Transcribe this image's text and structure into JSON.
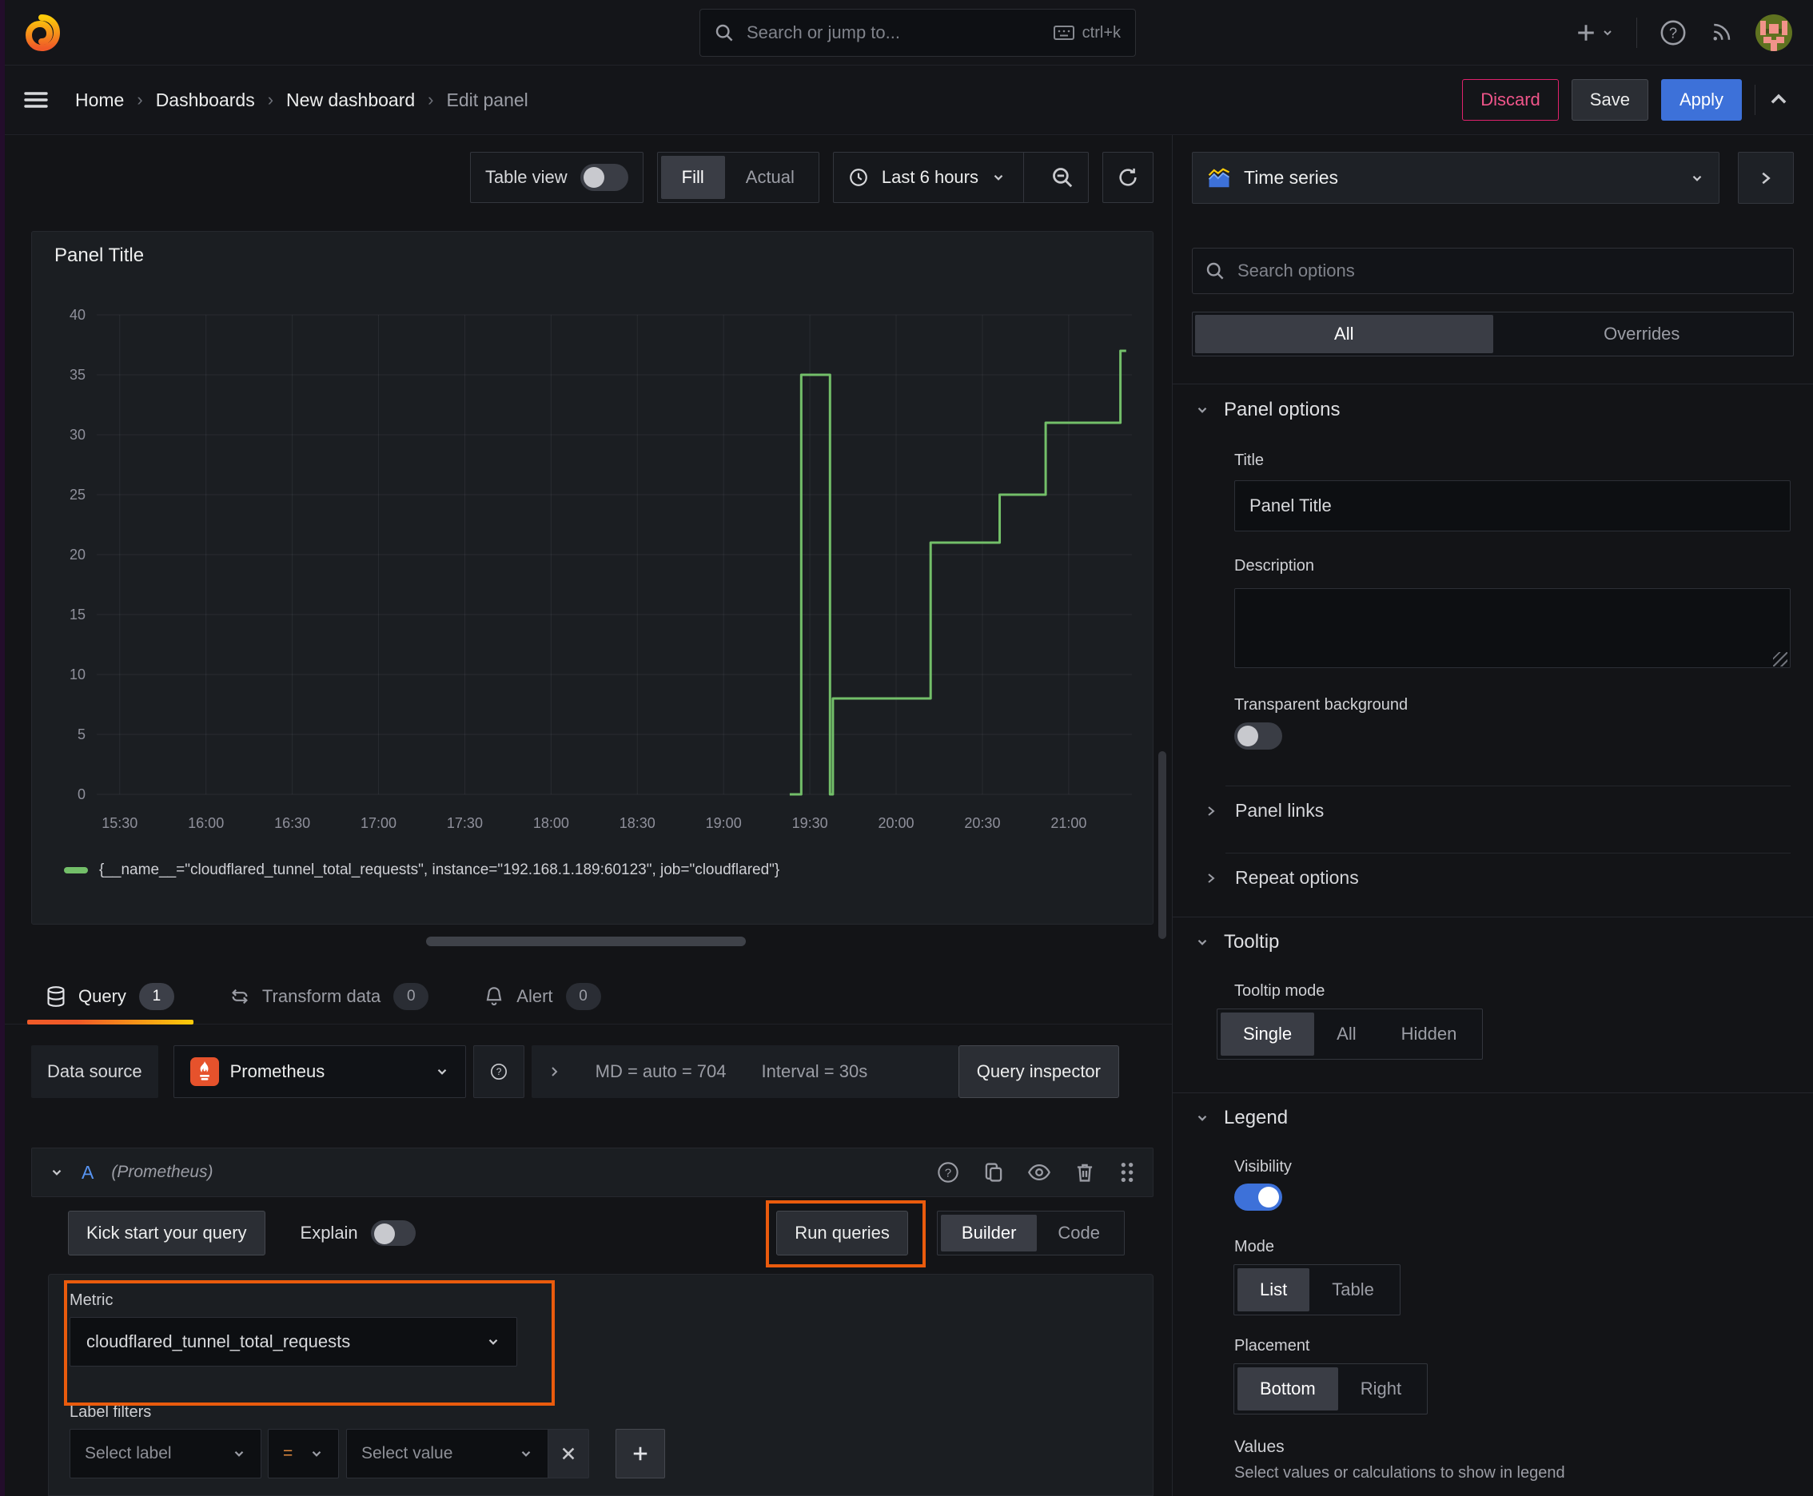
{
  "topbar": {
    "search_placeholder": "Search or jump to...",
    "shortcut": "ctrl+k"
  },
  "breadcrumb": {
    "items": [
      "Home",
      "Dashboards",
      "New dashboard",
      "Edit panel"
    ],
    "separator": "›"
  },
  "actions": {
    "discard": "Discard",
    "save": "Save",
    "apply": "Apply"
  },
  "toolbar": {
    "table_view": "Table view",
    "fill": "Fill",
    "actual": "Actual",
    "time_range": "Last 6 hours"
  },
  "panel": {
    "title": "Panel Title"
  },
  "chart_data": {
    "type": "line",
    "line_style": "step-after",
    "title": "Panel Title",
    "x_domain": [
      "15:22",
      "21:22"
    ],
    "x_ticks": [
      "15:30",
      "16:00",
      "16:30",
      "17:00",
      "17:30",
      "18:00",
      "18:30",
      "19:00",
      "19:30",
      "20:00",
      "20:30",
      "21:00"
    ],
    "ylim": [
      0,
      40
    ],
    "y_ticks": [
      0,
      5,
      10,
      15,
      20,
      25,
      30,
      35,
      40
    ],
    "grid": true,
    "legend_position": "bottom",
    "series": [
      {
        "name": "{__name__=\"cloudflared_tunnel_total_requests\", instance=\"192.168.1.189:60123\", job=\"cloudflared\"}",
        "color": "#73bf69",
        "points": [
          [
            "19:23",
            0
          ],
          [
            "19:27",
            35
          ],
          [
            "19:37",
            0
          ],
          [
            "19:38",
            8
          ],
          [
            "20:12",
            21
          ],
          [
            "20:36",
            25
          ],
          [
            "20:52",
            31
          ],
          [
            "21:18",
            37
          ],
          [
            "21:20",
            37
          ]
        ]
      }
    ]
  },
  "tabs": {
    "query": "Query",
    "query_count": "1",
    "transform": "Transform data",
    "transform_count": "0",
    "alert": "Alert",
    "alert_count": "0"
  },
  "query": {
    "data_source_label": "Data source",
    "data_source": "Prometheus",
    "md_stat": "MD = auto = 704",
    "interval_stat": "Interval = 30s",
    "inspector": "Query inspector",
    "ref_id": "A",
    "ref_ds": "(Prometheus)",
    "kickstart": "Kick start your query",
    "explain": "Explain",
    "run": "Run queries",
    "builder": "Builder",
    "code": "Code",
    "metric_label": "Metric",
    "metric_value": "cloudflared_tunnel_total_requests",
    "label_filters": "Label filters",
    "select_label": "Select label",
    "operator": "=",
    "select_value": "Select value"
  },
  "options": {
    "viz_type": "Time series",
    "search_placeholder": "Search options",
    "tab_all": "All",
    "tab_overrides": "Overrides",
    "panel_options": "Panel options",
    "title_label": "Title",
    "title_value": "Panel Title",
    "description_label": "Description",
    "transparent_label": "Transparent background",
    "panel_links": "Panel links",
    "repeat_options": "Repeat options",
    "tooltip": "Tooltip",
    "tooltip_mode": "Tooltip mode",
    "tooltip_single": "Single",
    "tooltip_all": "All",
    "tooltip_hidden": "Hidden",
    "legend": "Legend",
    "visibility": "Visibility",
    "mode": "Mode",
    "mode_list": "List",
    "mode_table": "Table",
    "placement": "Placement",
    "placement_bottom": "Bottom",
    "placement_right": "Right",
    "values": "Values",
    "values_desc": "Select values or calculations to show in legend"
  },
  "colors": {
    "annotation": "#ea5b0d",
    "accent_blue": "#3d71d9",
    "series_green": "#73bf69",
    "discard_pink": "#e0226c"
  }
}
